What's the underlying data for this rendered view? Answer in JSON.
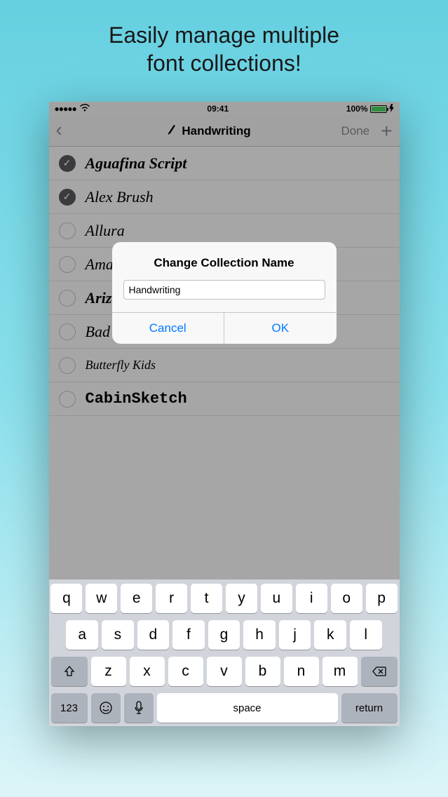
{
  "promo": {
    "line1": "Easily manage multiple",
    "line2": "font collections!"
  },
  "statusbar": {
    "time": "09:41",
    "battery_pct": "100%"
  },
  "nav": {
    "title": "Handwriting",
    "done": "Done"
  },
  "fonts": [
    {
      "name": "Aguafina Script",
      "checked": true
    },
    {
      "name": "Alex Brush",
      "checked": true
    },
    {
      "name": "Allura",
      "checked": false
    },
    {
      "name": "Amatic SC",
      "checked": false
    },
    {
      "name": "Arizonia",
      "checked": false
    },
    {
      "name": "Bad Script",
      "checked": false
    },
    {
      "name": "Butterfly Kids",
      "checked": false
    },
    {
      "name": "CabinSketch",
      "checked": false
    }
  ],
  "alert": {
    "title": "Change Collection Name",
    "input_value": "Handwriting",
    "cancel": "Cancel",
    "ok": "OK"
  },
  "keyboard": {
    "row1": [
      "q",
      "w",
      "e",
      "r",
      "t",
      "y",
      "u",
      "i",
      "o",
      "p"
    ],
    "row2": [
      "a",
      "s",
      "d",
      "f",
      "g",
      "h",
      "j",
      "k",
      "l"
    ],
    "row3": [
      "z",
      "x",
      "c",
      "v",
      "b",
      "n",
      "m"
    ],
    "numbers": "123",
    "space": "space",
    "return": "return"
  }
}
